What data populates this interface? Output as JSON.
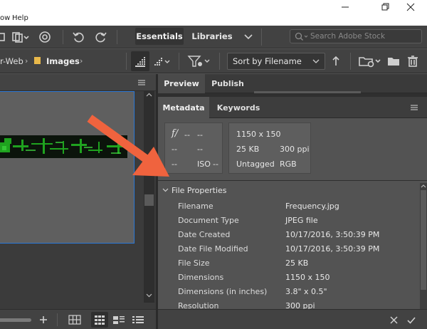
{
  "menu": {
    "view_label": "ow",
    "help_label": "Help"
  },
  "workspaces": {
    "essentials": "Essentials",
    "libraries": "Libraries"
  },
  "search": {
    "placeholder": "Search Adobe Stock"
  },
  "breadcrumb": {
    "parent": "r-Web",
    "current": "Images"
  },
  "sort": {
    "label": "Sort by Filename"
  },
  "right_tabs": {
    "preview": "Preview",
    "publish": "Publish"
  },
  "meta_tabs": {
    "metadata": "Metadata",
    "keywords": "Keywords"
  },
  "camera": {
    "aperture_symbol": "f/",
    "aperture": "--",
    "shutter": "--",
    "row2_a": "--",
    "row2_b": "--",
    "row3_a": "--",
    "iso_label": "ISO",
    "iso": "--"
  },
  "image_info": {
    "dimensions": "1150 x 150",
    "size": "25 KB",
    "resolution": "300 ppi",
    "color_profile": "Untagged",
    "color_mode": "RGB"
  },
  "file_properties": {
    "title": "File Properties",
    "rows": [
      {
        "key": "Filename",
        "value": "Frequency.jpg"
      },
      {
        "key": "Document Type",
        "value": "JPEG file"
      },
      {
        "key": "Date Created",
        "value": "10/17/2016, 3:50:39 PM"
      },
      {
        "key": "Date File Modified",
        "value": "10/17/2016, 3:50:39 PM"
      },
      {
        "key": "File Size",
        "value": "25 KB"
      },
      {
        "key": "Dimensions",
        "value": "1150 x 150"
      },
      {
        "key": "Dimensions (in inches)",
        "value": "3.8\" x 0.5\""
      },
      {
        "key": "Resolution",
        "value": "300 ppi"
      }
    ]
  },
  "colors": {
    "accent_blue": "#2b78d6",
    "arrow_orange": "#f0633e",
    "panel_bg": "#535353"
  }
}
